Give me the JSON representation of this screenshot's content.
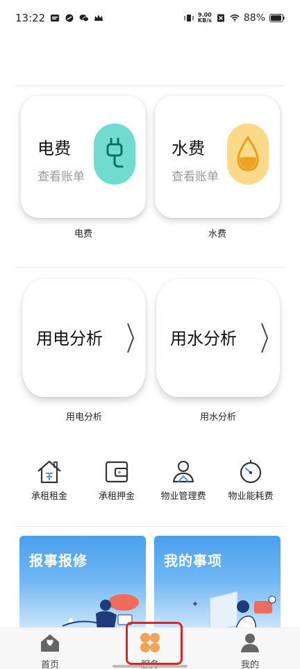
{
  "status_bar": {
    "time": "13:22",
    "net_speed_value": "9.00",
    "net_speed_unit": "KB/s",
    "battery": "88%"
  },
  "bill_cards": [
    {
      "title": "电费",
      "subtitle": "查看账单",
      "caption": "电费",
      "icon": "plug-icon",
      "accent": "#6fdccf"
    },
    {
      "title": "水费",
      "subtitle": "查看账单",
      "caption": "水费",
      "icon": "water-drop-icon",
      "accent": "#fad98a"
    }
  ],
  "analysis_cards": [
    {
      "title": "用电分析",
      "caption": "用电分析"
    },
    {
      "title": "用水分析",
      "caption": "用水分析"
    }
  ],
  "quick_actions": [
    {
      "label": "承租租金",
      "icon": "house-icon"
    },
    {
      "label": "承租押金",
      "icon": "wallet-icon"
    },
    {
      "label": "物业管理费",
      "icon": "person-icon"
    },
    {
      "label": "物业能耗费",
      "icon": "gauge-icon"
    }
  ],
  "promos": [
    {
      "title": "报事报修"
    },
    {
      "title": "我的事项"
    }
  ],
  "tabbar": {
    "items": [
      {
        "label": "首页",
        "icon": "home-icon"
      },
      {
        "label": "服务",
        "icon": "service-grid-icon",
        "active": true
      },
      {
        "label": "我的",
        "icon": "user-icon"
      }
    ],
    "active_color": "#f4a356",
    "highlight_color": "#d6262b"
  }
}
